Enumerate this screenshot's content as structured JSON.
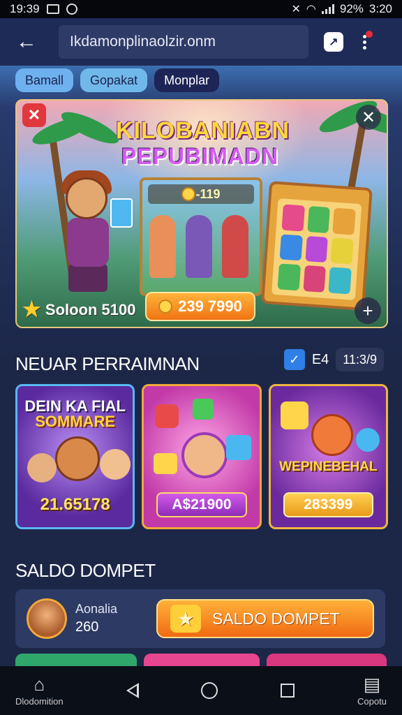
{
  "status_bar": {
    "time_left": "19:39",
    "battery": "92%",
    "time_right": "3:20"
  },
  "top_bar": {
    "url": "Ikdamonplinaolzir.onm",
    "icons": [
      "back-arrow-icon",
      "share-icon",
      "menu-dots-icon"
    ]
  },
  "chips": [
    "Bamall",
    "Gopakat",
    "Monplar"
  ],
  "banner": {
    "title_line1": "KILOBANIABN",
    "title_line2": "PEPUBIMADN",
    "counter": "-119",
    "price": "239 7990",
    "score": "Soloon 5100"
  },
  "section1": {
    "title": "NEUAR PERRAIMNAN",
    "count": "E4",
    "time": "11:3/9"
  },
  "games": [
    {
      "title_line1": "DEIN KA FIAL",
      "title_line2": "SOMMARE",
      "price": "21.65178"
    },
    {
      "title_line1": "",
      "title_line2": "",
      "price": "A$21900"
    },
    {
      "title_line1": "WEPINEBEHAL",
      "title_line2": "",
      "price": "283399"
    }
  ],
  "section2": {
    "title": "SALDO DOMPET"
  },
  "wallet": {
    "name": "Aonalia",
    "amount": "260",
    "button_label": "SALDO DOMPET"
  },
  "nav": {
    "left_label": "Dlodomition",
    "right_label": "Copotu"
  },
  "colors": {
    "accent_orange": "#f07414",
    "background": "#1c2748",
    "checkbox_blue": "#2f7fe6"
  }
}
